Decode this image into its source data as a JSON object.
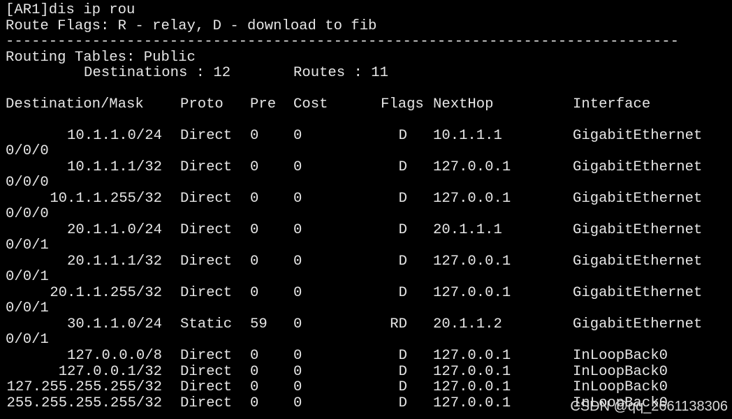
{
  "terminal": {
    "command": "[AR1]dis ip rou",
    "flags_legend": "Route Flags: R - relay, D - download to fib",
    "separator": "------------------------------------------------------------------------------",
    "routing_tables_label": "Routing Tables: Public",
    "destinations_label": "Destinations : 12",
    "routes_label": "Routes : 11",
    "headers": {
      "destination": "Destination/Mask",
      "proto": "Proto",
      "pre": "Pre",
      "cost": "Cost",
      "flags": "Flags",
      "nexthop": "NextHop",
      "interface": "Interface"
    },
    "routes": [
      {
        "dest": "10.1.1.0/24",
        "proto": "Direct",
        "pre": "0",
        "cost": "0",
        "flags": "D",
        "nexthop": "10.1.1.1",
        "iface": "GigabitEthernet",
        "iface_cont": "0/0/0"
      },
      {
        "dest": "10.1.1.1/32",
        "proto": "Direct",
        "pre": "0",
        "cost": "0",
        "flags": "D",
        "nexthop": "127.0.0.1",
        "iface": "GigabitEthernet",
        "iface_cont": "0/0/0"
      },
      {
        "dest": "10.1.1.255/32",
        "proto": "Direct",
        "pre": "0",
        "cost": "0",
        "flags": "D",
        "nexthop": "127.0.0.1",
        "iface": "GigabitEthernet",
        "iface_cont": "0/0/0"
      },
      {
        "dest": "20.1.1.0/24",
        "proto": "Direct",
        "pre": "0",
        "cost": "0",
        "flags": "D",
        "nexthop": "20.1.1.1",
        "iface": "GigabitEthernet",
        "iface_cont": "0/0/1"
      },
      {
        "dest": "20.1.1.1/32",
        "proto": "Direct",
        "pre": "0",
        "cost": "0",
        "flags": "D",
        "nexthop": "127.0.0.1",
        "iface": "GigabitEthernet",
        "iface_cont": "0/0/1"
      },
      {
        "dest": "20.1.1.255/32",
        "proto": "Direct",
        "pre": "0",
        "cost": "0",
        "flags": "D",
        "nexthop": "127.0.0.1",
        "iface": "GigabitEthernet",
        "iface_cont": "0/0/1"
      },
      {
        "dest": "30.1.1.0/24",
        "proto": "Static",
        "pre": "59",
        "cost": "0",
        "flags": "RD",
        "nexthop": "20.1.1.2",
        "iface": "GigabitEthernet",
        "iface_cont": "0/0/1"
      },
      {
        "dest": "127.0.0.0/8",
        "proto": "Direct",
        "pre": "0",
        "cost": "0",
        "flags": "D",
        "nexthop": "127.0.0.1",
        "iface": "InLoopBack0",
        "iface_cont": ""
      },
      {
        "dest": "127.0.0.1/32",
        "proto": "Direct",
        "pre": "0",
        "cost": "0",
        "flags": "D",
        "nexthop": "127.0.0.1",
        "iface": "InLoopBack0",
        "iface_cont": ""
      },
      {
        "dest": "127.255.255.255/32",
        "proto": "Direct",
        "pre": "0",
        "cost": "0",
        "flags": "D",
        "nexthop": "127.0.0.1",
        "iface": "InLoopBack0",
        "iface_cont": ""
      },
      {
        "dest": "255.255.255.255/32",
        "proto": "Direct",
        "pre": "0",
        "cost": "0",
        "flags": "D",
        "nexthop": "127.0.0.1",
        "iface": "InLoopBack0",
        "iface_cont": ""
      }
    ]
  },
  "watermark": "CSDN @qq_2661138306",
  "colors": {
    "background": "#000000",
    "text": "#e6e6e6"
  }
}
